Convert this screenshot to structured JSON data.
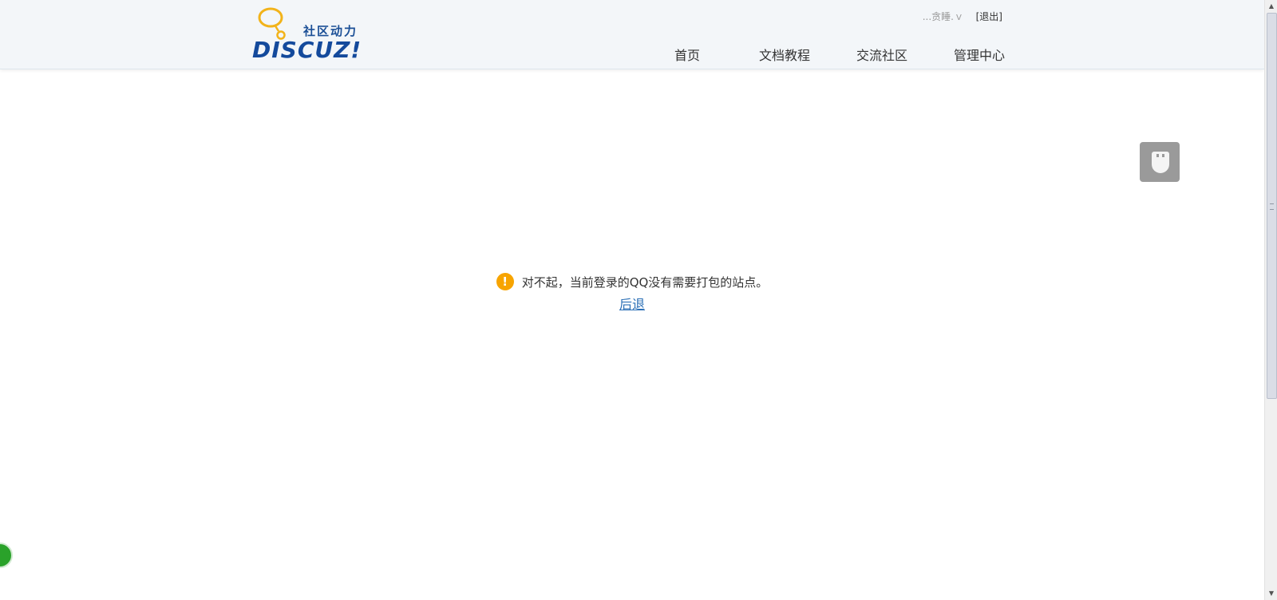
{
  "header": {
    "logo": {
      "tagline": "社区动力",
      "brand": "DISCUZ!"
    },
    "user": {
      "name": "...贪睡.",
      "caret": "V",
      "logout": "[退出]"
    },
    "nav": [
      {
        "label": "首页"
      },
      {
        "label": "文档教程"
      },
      {
        "label": "交流社区"
      },
      {
        "label": "管理中心"
      }
    ]
  },
  "main": {
    "message": "对不起，当前登录的QQ没有需要打包的站点。",
    "back_link": "后退",
    "icon": "warning-icon"
  },
  "colors": {
    "header_bg": "#f3f6f9",
    "brand_blue": "#144a9c",
    "logo_yellow": "#f2b31a",
    "warning": "#f7a400",
    "link": "#2b6fb6"
  }
}
